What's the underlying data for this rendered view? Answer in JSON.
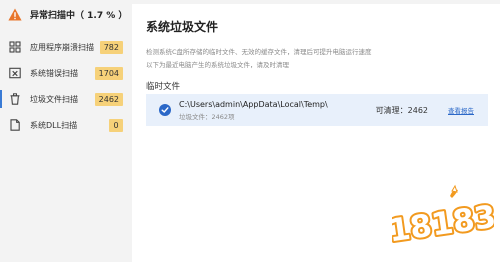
{
  "scan": {
    "title": "异常扫描中（ 1.7 % ）",
    "progress_percent": 1.7
  },
  "sidebar": {
    "items": [
      {
        "label": "应用程序崩溃扫描",
        "count": "782",
        "icon": "app-crash-icon",
        "active": false
      },
      {
        "label": "系统错误扫描",
        "count": "1704",
        "icon": "system-error-icon",
        "active": false
      },
      {
        "label": "垃圾文件扫描",
        "count": "2462",
        "icon": "trash-icon",
        "active": true
      },
      {
        "label": "系统DLL扫描",
        "count": "0",
        "icon": "dll-icon",
        "active": false
      }
    ]
  },
  "main": {
    "title": "系统垃圾文件",
    "description_line1": "检测系统C盘所存储的临时文件、无效的缓存文件，清理后可提升电脑运行速度",
    "description_line2": "以下为最近电脑产生的系统垃圾文件，请及时清理",
    "section_label": "临时文件",
    "entry": {
      "path": "C:\\Users\\admin\\AppData\\Local\\Temp\\",
      "count_text": "垃圾文件：2462项",
      "clean_text": "可清理：2462",
      "report_link": "查看报告"
    }
  },
  "watermark": {
    "text": "18183"
  },
  "colors": {
    "accent": "#2b68c8",
    "badge": "#f6d179",
    "warning": "#e8762b",
    "sidebar_bg": "#f3f3f3",
    "entry_bg": "#e8f0fb"
  }
}
